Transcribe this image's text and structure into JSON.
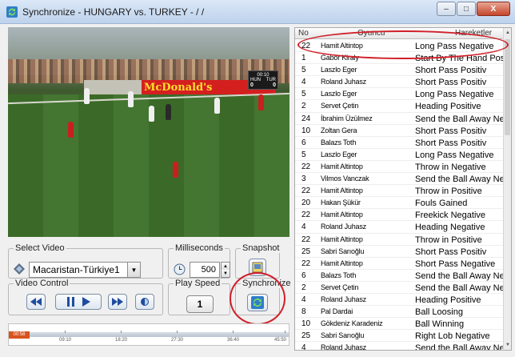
{
  "window": {
    "title": "Synchronize - HUNGARY vs. TURKEY -  / /",
    "minimize_label": "–",
    "maximize_label": "□",
    "close_label": "X"
  },
  "scoreboard": {
    "team_home": "HUN",
    "team_away": "TUR",
    "score_home": "0",
    "score_away": "0",
    "time": "00:10"
  },
  "board_text": "McDonald's",
  "select_video": {
    "label": "Select Video",
    "value": "Macaristan-Türkiye1"
  },
  "milliseconds": {
    "label": "Milliseconds",
    "value": "500"
  },
  "snapshot": {
    "label": "Snapshot"
  },
  "video_control": {
    "label": "Video Control"
  },
  "play_speed": {
    "label": "Play Speed",
    "value": "1"
  },
  "synchronize": {
    "label": "Synchronize"
  },
  "timeline": {
    "current": "00:58",
    "ticks": [
      "09:10",
      "18:20",
      "27:30",
      "36:40",
      "45:50"
    ]
  },
  "table": {
    "columns": [
      "No",
      "Oyuncu",
      "Hareketler"
    ],
    "rows": [
      [
        "22",
        "Hamit Altintop",
        "Long Pass Negative"
      ],
      [
        "1",
        "Gabor Kiraly",
        "Start By The Hand Pos"
      ],
      [
        "5",
        "Laszlo Eger",
        "Short Pass Positiv"
      ],
      [
        "4",
        "Roland Juhasz",
        "Short Pass Positiv"
      ],
      [
        "5",
        "Laszlo Eger",
        "Long Pass Negative"
      ],
      [
        "2",
        "Servet Çetin",
        "Heading Positive"
      ],
      [
        "24",
        "İbrahim Üzülmez",
        "Send the Ball Away Ne"
      ],
      [
        "10",
        "Zoltan Gera",
        "Short Pass Positiv"
      ],
      [
        "6",
        "Balazs Toth",
        "Short Pass Positiv"
      ],
      [
        "5",
        "Laszlo Eger",
        "Long Pass Negative"
      ],
      [
        "22",
        "Hamit Altintop",
        "Throw in Negative"
      ],
      [
        "3",
        "Vilmos Vanczak",
        "Send the Ball Away Ne"
      ],
      [
        "22",
        "Hamit Altintop",
        "Throw in Positive"
      ],
      [
        "20",
        "Hakan Şükür",
        "Fouls Gained"
      ],
      [
        "22",
        "Hamit Altintop",
        "Freekick Negative"
      ],
      [
        "4",
        "Roland Juhasz",
        "Heading Negative"
      ],
      [
        "22",
        "Hamit Altintop",
        "Throw in Positive"
      ],
      [
        "25",
        "Sabri Sarıoğlu",
        "Short Pass Positiv"
      ],
      [
        "22",
        "Hamit Altintop",
        "Short Pass Negative"
      ],
      [
        "6",
        "Balazs Toth",
        "Send the Ball Away Ne"
      ],
      [
        "2",
        "Servet Çetin",
        "Send the Ball Away Ne"
      ],
      [
        "4",
        "Roland Juhasz",
        "Heading Positive"
      ],
      [
        "8",
        "Pal Dardai",
        "Ball Loosing"
      ],
      [
        "10",
        "Gökdeniz Karadeniz",
        "Ball Winning"
      ],
      [
        "25",
        "Sabri Sarıoğlu",
        "Right Lob Negative"
      ],
      [
        "4",
        "Roland Juhasz",
        "Send the Ball Away Ne"
      ]
    ]
  }
}
